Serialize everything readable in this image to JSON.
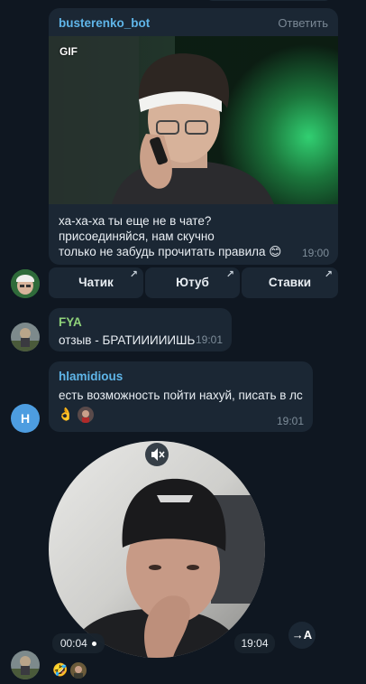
{
  "message1": {
    "sender": "busterenko_bot",
    "reply_label": "Ответить",
    "gif_badge": "GIF",
    "text": "ха-ха-ха ты еще не в чате?\nприсоединяйся, нам скучно\nтолько не забудь прочитать правила 😊",
    "time": "19:00",
    "buttons": [
      {
        "label": "Чатик"
      },
      {
        "label": "Ютуб"
      },
      {
        "label": "Ставки"
      }
    ]
  },
  "message2": {
    "sender": "FYA",
    "text": "отзыв -  БРАТИИИИИШЬ",
    "time": "19:01"
  },
  "message3": {
    "sender": "hlamidious",
    "text": "есть возможность пойти нахуй, писать в лс",
    "avatar_letter": "H",
    "reactions": [
      "👌"
    ],
    "time": "19:01"
  },
  "message4": {
    "video_duration": "00:04",
    "time": "19:04",
    "translate_label": "A",
    "reactions": [
      "🤣"
    ]
  },
  "colors": {
    "background": "#0f1721",
    "bubble": "#1b2734",
    "sender_blue": "#5fb5e8",
    "sender_green": "#8fd27a",
    "avatar_h": "#4d9de0"
  },
  "icons": {
    "mute": "speaker-muted-icon",
    "translate": "translate-arrow-icon",
    "external_link": "arrow-up-right-icon"
  }
}
